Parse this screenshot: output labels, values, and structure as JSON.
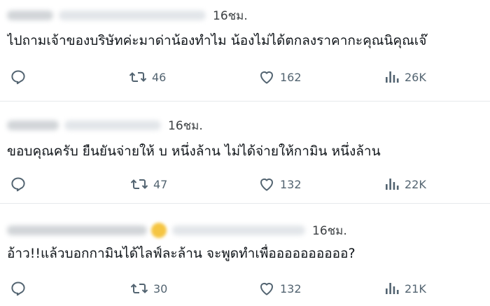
{
  "tweets": [
    {
      "time": "16ชม.",
      "text": "ไปถามเจ้าของบริษัทค่ะมาด่าน้องทำไม น้องไม่ได้ตกลงราคากะคุณนิคุณเจ๊",
      "retweets": "46",
      "likes": "162",
      "views": "26K"
    },
    {
      "time": "16ชม.",
      "text": "ขอบคุณครับ ยืนยันจ่ายให้ บ หนึ่งล้าน ไม่ได้จ่ายให้กามิน หนึ่งล้าน",
      "retweets": "47",
      "likes": "132",
      "views": "22K"
    },
    {
      "time": "16ชม.",
      "text": "อ้าว!!แล้วบอกกามินได้ไลฟ์ละล้าน จะพูดทำเพื่ออออออออออ?",
      "retweets": "30",
      "likes": "132",
      "views": "21K"
    }
  ],
  "icons": {
    "reply": "reply-icon",
    "retweet": "retweet-icon",
    "like": "heart-icon",
    "views": "views-icon"
  },
  "colors": {
    "text": "#0f1419",
    "icon": "#536471",
    "divider": "#e6e9ec"
  }
}
